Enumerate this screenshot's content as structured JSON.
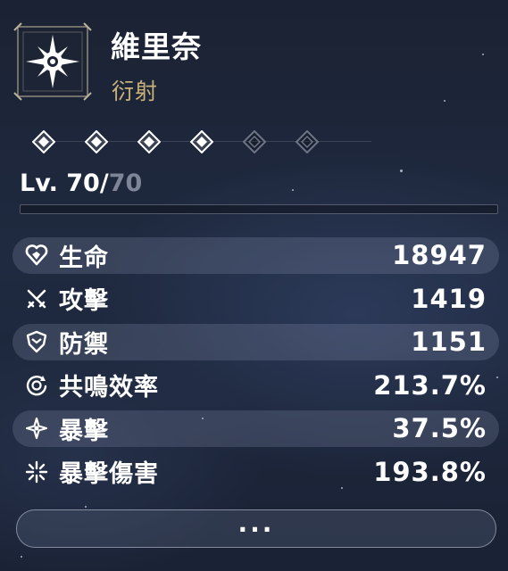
{
  "character": {
    "name": "維里奈",
    "attribute": "衍射",
    "attribute_icon": "spectro-sun-icon",
    "attribute_color": "#c8b27a"
  },
  "sequence": {
    "total": 6,
    "unlocked": 4,
    "unlocked_color": "#ffffff",
    "locked_color": "#6d7486"
  },
  "level": {
    "label": "Lv. ",
    "current": "70",
    "separator": "/",
    "max": "70"
  },
  "stats": [
    {
      "key": "hp",
      "icon": "heart-icon",
      "label": "生命",
      "value": "18947"
    },
    {
      "key": "atk",
      "icon": "crossed-swords-icon",
      "label": "攻擊",
      "value": "1419"
    },
    {
      "key": "def",
      "icon": "shield-icon",
      "label": "防禦",
      "value": "1151"
    },
    {
      "key": "energy_regen",
      "icon": "energy-regen-icon",
      "label": "共鳴效率",
      "value": "213.7%"
    },
    {
      "key": "crit_rate",
      "icon": "crit-star-icon",
      "label": "暴擊",
      "value": "37.5%"
    },
    {
      "key": "crit_dmg",
      "icon": "crit-burst-icon",
      "label": "暴擊傷害",
      "value": "193.8%"
    }
  ],
  "more_button": {
    "label": "..."
  }
}
